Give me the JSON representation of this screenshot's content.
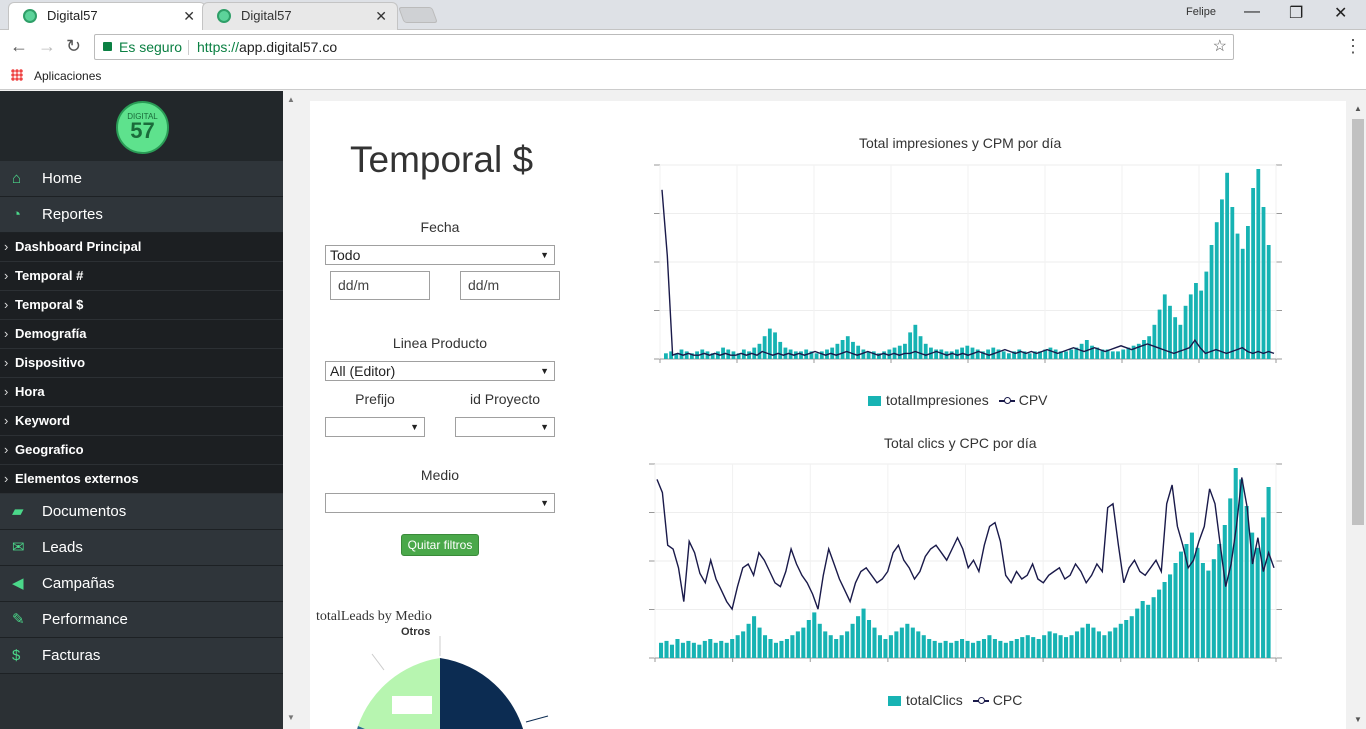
{
  "browser": {
    "tabs": [
      {
        "title": "Digital57",
        "active": true
      },
      {
        "title": "Digital57",
        "active": false
      }
    ],
    "user": "Felipe",
    "secure_label": "Es seguro",
    "url_scheme": "https://",
    "url_host": "app.digital57.co",
    "bookmarks_label": "Aplicaciones"
  },
  "sidebar": {
    "logo_top": "DIGITAL",
    "logo_num": "57",
    "main_items": [
      {
        "label": "Home",
        "icon": "home-icon"
      },
      {
        "label": "Reportes",
        "icon": "dashboard-icon"
      }
    ],
    "sub_items": [
      "Dashboard Principal",
      "Temporal #",
      "Temporal $",
      "Demografía",
      "Dispositivo",
      "Hora",
      "Keyword",
      "Geografico",
      "Elementos externos"
    ],
    "bottom_items": [
      {
        "label": "Documentos",
        "icon": "folder-icon"
      },
      {
        "label": "Leads",
        "icon": "envelope-icon"
      },
      {
        "label": "Campañas",
        "icon": "megaphone-icon"
      },
      {
        "label": "Performance",
        "icon": "wrench-icon"
      },
      {
        "label": "Facturas",
        "icon": "dollar-icon"
      }
    ]
  },
  "main": {
    "title": "Temporal $",
    "fecha_label": "Fecha",
    "fecha_value": "Todo",
    "date_from_placeholder": "dd/m",
    "date_to_placeholder": "dd/m",
    "linea_label": "Linea Producto",
    "linea_value": "All (Editor)",
    "prefijo_label": "Prefijo",
    "idproyecto_label": "id Proyecto",
    "medio_label": "Medio",
    "clear_button": "Quitar filtros",
    "pie_title": "totalLeads by Medio",
    "pie_label": "Otros"
  },
  "chart_data": [
    {
      "type": "bar",
      "title": "Total impresiones y CPM por día",
      "series": [
        {
          "name": "totalImpresiones",
          "kind": "bar",
          "color": "#17b3b3",
          "values": [
            3,
            4,
            3,
            5,
            4,
            3,
            4,
            5,
            4,
            3,
            4,
            6,
            5,
            4,
            3,
            5,
            4,
            6,
            8,
            12,
            16,
            14,
            9,
            6,
            5,
            4,
            4,
            5,
            4,
            3,
            4,
            5,
            6,
            8,
            10,
            12,
            9,
            7,
            5,
            4,
            4,
            3,
            4,
            5,
            6,
            7,
            8,
            14,
            18,
            12,
            8,
            6,
            5,
            5,
            4,
            4,
            5,
            6,
            7,
            6,
            5,
            4,
            5,
            6,
            5,
            4,
            3,
            4,
            5,
            4,
            3,
            4,
            4,
            5,
            6,
            5,
            4,
            4,
            5,
            6,
            8,
            10,
            7,
            6,
            5,
            5,
            4,
            4,
            5,
            6,
            7,
            8,
            10,
            12,
            18,
            26,
            34,
            28,
            22,
            18,
            28,
            34,
            40,
            36,
            46,
            60,
            72,
            84,
            98,
            80,
            66,
            58,
            70,
            90,
            100,
            80,
            60
          ]
        },
        {
          "name": "CPV",
          "kind": "line",
          "color": "#1a1a4a",
          "values": [
            90,
            55,
            2,
            3,
            2,
            3,
            2,
            2,
            3,
            2,
            3,
            2,
            3,
            2,
            2,
            3,
            2,
            3,
            2,
            4,
            3,
            2,
            3,
            2,
            3,
            2,
            3,
            2,
            3,
            4,
            3,
            2,
            3,
            2,
            3,
            4,
            3,
            2,
            3,
            4,
            3,
            2,
            3,
            2,
            3,
            2,
            3,
            3,
            4,
            3,
            2,
            3,
            4,
            3,
            2,
            3,
            2,
            3,
            2,
            3,
            4,
            3,
            2,
            3,
            4,
            5,
            4,
            3,
            4,
            3,
            4,
            3,
            4,
            5,
            4,
            3,
            4,
            5,
            6,
            5,
            4,
            5,
            6,
            5,
            4,
            5,
            6,
            7,
            6,
            5,
            6,
            7,
            8,
            7,
            6,
            5,
            4,
            3,
            4,
            5,
            6,
            10,
            6,
            3,
            4,
            5,
            4,
            3,
            4,
            5,
            6,
            4,
            3,
            4,
            3,
            4,
            3
          ]
        }
      ]
    },
    {
      "type": "bar",
      "title": "Total clics y CPC por día",
      "series": [
        {
          "name": "totalClics",
          "kind": "bar",
          "color": "#17b3b3",
          "values": [
            8,
            9,
            7,
            10,
            8,
            9,
            8,
            7,
            9,
            10,
            8,
            9,
            8,
            10,
            12,
            14,
            18,
            22,
            16,
            12,
            10,
            8,
            9,
            10,
            12,
            14,
            16,
            20,
            24,
            18,
            14,
            12,
            10,
            12,
            14,
            18,
            22,
            26,
            20,
            16,
            12,
            10,
            12,
            14,
            16,
            18,
            16,
            14,
            12,
            10,
            9,
            8,
            9,
            8,
            9,
            10,
            9,
            8,
            9,
            10,
            12,
            10,
            9,
            8,
            9,
            10,
            11,
            12,
            11,
            10,
            12,
            14,
            13,
            12,
            11,
            12,
            14,
            16,
            18,
            16,
            14,
            12,
            14,
            16,
            18,
            20,
            22,
            26,
            30,
            28,
            32,
            36,
            40,
            44,
            50,
            56,
            60,
            66,
            58,
            50,
            46,
            52,
            60,
            70,
            84,
            100,
            94,
            80,
            66,
            58,
            74,
            90
          ]
        },
        {
          "name": "CPC",
          "kind": "line",
          "color": "#1a1a4a",
          "values": [
            95,
            88,
            60,
            58,
            48,
            30,
            62,
            56,
            45,
            40,
            52,
            42,
            36,
            30,
            26,
            38,
            48,
            50,
            44,
            56,
            52,
            46,
            40,
            38,
            46,
            58,
            50,
            44,
            40,
            34,
            26,
            44,
            58,
            50,
            42,
            36,
            30,
            40,
            46,
            48,
            44,
            40,
            42,
            46,
            56,
            60,
            52,
            48,
            42,
            46,
            54,
            58,
            60,
            56,
            52,
            58,
            64,
            58,
            48,
            52,
            46,
            60,
            70,
            72,
            62,
            44,
            40,
            46,
            42,
            44,
            50,
            42,
            40,
            44,
            46,
            48,
            42,
            44,
            50,
            46,
            40,
            44,
            50,
            46,
            80,
            82,
            60,
            40,
            48,
            52,
            46,
            44,
            48,
            52,
            46,
            82,
            92,
            70,
            60,
            48,
            52,
            62,
            70,
            90,
            82,
            60,
            38,
            50,
            70,
            96,
            80,
            50,
            64,
            46,
            56,
            48
          ]
        }
      ]
    }
  ]
}
